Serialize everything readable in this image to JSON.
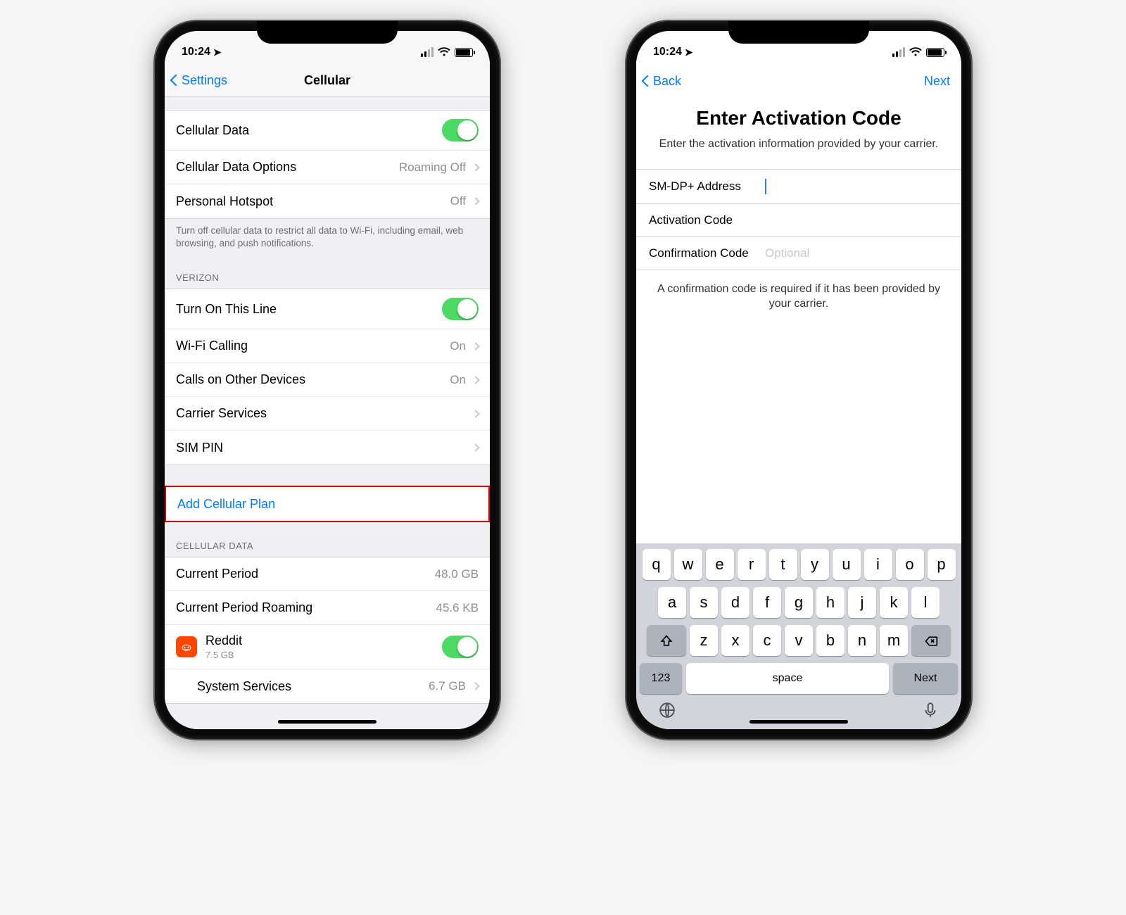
{
  "status": {
    "time": "10:24",
    "loc_glyph": "➤"
  },
  "left": {
    "nav_back": "Settings",
    "nav_title": "Cellular",
    "rows": {
      "cellular_data": "Cellular Data",
      "data_options": "Cellular Data Options",
      "data_options_detail": "Roaming Off",
      "hotspot": "Personal Hotspot",
      "hotspot_detail": "Off"
    },
    "footer1": "Turn off cellular data to restrict all data to Wi-Fi, including email, web browsing, and push notifications.",
    "carrier_header": "VERIZON",
    "carrier_rows": {
      "turn_on": "Turn On This Line",
      "wifi_calling": "Wi-Fi Calling",
      "wifi_calling_detail": "On",
      "other_devices": "Calls on Other Devices",
      "other_devices_detail": "On",
      "carrier_services": "Carrier Services",
      "sim_pin": "SIM PIN"
    },
    "add_plan": "Add Cellular Plan",
    "data_header": "CELLULAR DATA",
    "data_rows": {
      "current": "Current Period",
      "current_val": "48.0 GB",
      "roaming": "Current Period Roaming",
      "roaming_val": "45.6 KB",
      "app_name": "Reddit",
      "app_val": "7.5 GB",
      "system": "System Services",
      "system_val": "6.7 GB"
    }
  },
  "right": {
    "nav_back": "Back",
    "nav_next": "Next",
    "title": "Enter Activation Code",
    "subtitle": "Enter the activation information provided by your carrier.",
    "fields": {
      "smdp": "SM-DP+ Address",
      "activation": "Activation Code",
      "confirmation": "Confirmation Code",
      "confirmation_ph": "Optional"
    },
    "note": "A confirmation code is required if it has been provided by your carrier.",
    "keyboard": {
      "row1": [
        "q",
        "w",
        "e",
        "r",
        "t",
        "y",
        "u",
        "i",
        "o",
        "p"
      ],
      "row2": [
        "a",
        "s",
        "d",
        "f",
        "g",
        "h",
        "j",
        "k",
        "l"
      ],
      "row3": [
        "z",
        "x",
        "c",
        "v",
        "b",
        "n",
        "m"
      ],
      "num": "123",
      "space": "space",
      "next": "Next"
    }
  }
}
